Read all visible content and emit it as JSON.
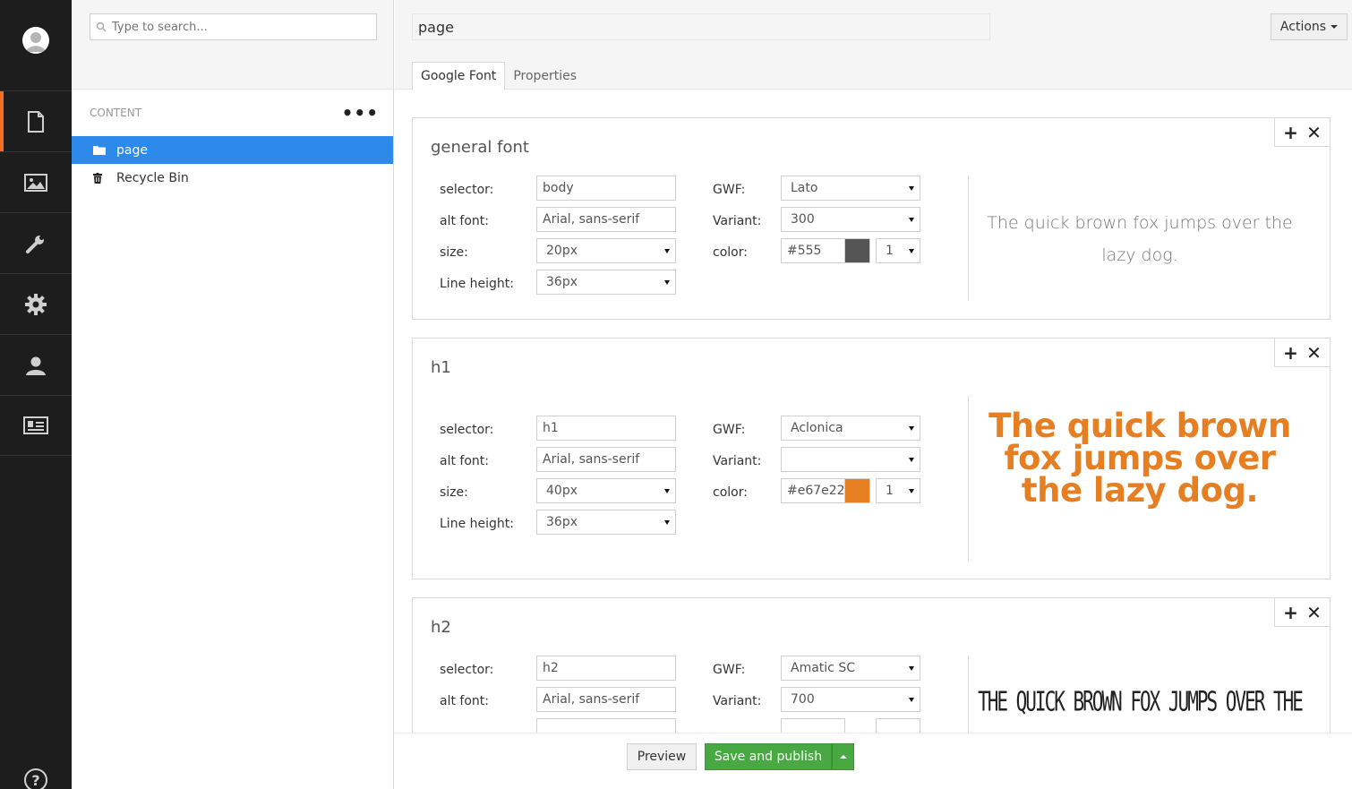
{
  "tree": {
    "search_placeholder": "Type to search...",
    "section_label": "CONTENT",
    "more_label": "•••",
    "nodes": [
      {
        "label": "page",
        "icon": "folder-icon",
        "selected": true
      },
      {
        "label": "Recycle Bin",
        "icon": "trash-icon",
        "selected": false
      }
    ]
  },
  "appbar": {
    "items": [
      "content-icon",
      "media-icon",
      "settings-wrench-icon",
      "developer-gear-icon",
      "users-icon",
      "members-icon"
    ],
    "active": "content-icon",
    "accent": "#f36f21",
    "help_label": "?"
  },
  "header": {
    "page_name": "page",
    "actions_label": "Actions",
    "tabs": [
      {
        "label": "Google Font",
        "active": true
      },
      {
        "label": "Properties",
        "active": false
      }
    ]
  },
  "fields": {
    "selector_label": "selector:",
    "alt_font_label": "alt font:",
    "size_label": "size:",
    "line_height_label": "Line height:",
    "gwf_label": "GWF:",
    "variant_label": "Variant:",
    "color_label": "color:",
    "add_symbol": "+",
    "remove_symbol": "✕"
  },
  "cards": [
    {
      "title": "general font",
      "selector": "body",
      "alt_font": "Arial, sans-serif",
      "size": "20px",
      "line_height": "36px",
      "gwf": "Lato",
      "variant": "300",
      "color_text": "#555",
      "color_hex": "#555555",
      "opacity": "1",
      "preview_text": "The quick brown fox jumps over the lazy dog."
    },
    {
      "title": "h1",
      "selector": "h1",
      "alt_font": "Arial, sans-serif",
      "size": "40px",
      "line_height": "36px",
      "gwf": "Aclonica",
      "variant": "",
      "color_text": "#e67e22",
      "color_hex": "#e67e22",
      "opacity": "1",
      "preview_text": "The quick brown fox jumps over the lazy dog."
    },
    {
      "title": "h2",
      "selector": "h2",
      "alt_font": "Arial, sans-serif",
      "gwf": "Amatic SC",
      "variant": "700",
      "preview_text": "THE QUICK BROWN FOX JUMPS OVER THE"
    }
  ],
  "footer": {
    "preview_label": "Preview",
    "save_label": "Save and publish",
    "save_color": "#48a842"
  }
}
